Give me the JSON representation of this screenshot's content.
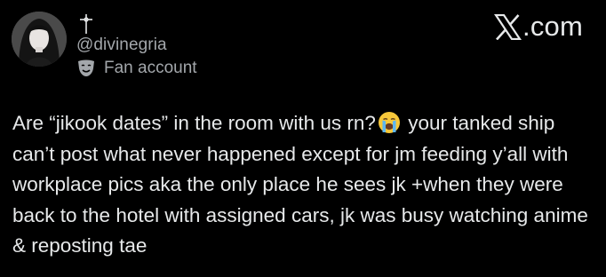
{
  "brand": {
    "logo_icon": "x-logo-icon",
    "suffix": ".com"
  },
  "author": {
    "name_icon": "dagger-cross-icon",
    "handle": "@divinegria",
    "badge_icon": "theater-mask-icon",
    "badge_label": "Fan account"
  },
  "tweet": {
    "text_before_emoji": "Are “jikook dates” in the room with us rn?",
    "emoji": "loudly-crying-face-emoji",
    "text_after_emoji": " your tanked ship can’t post what never happened except for jm feeding y’all with workplace pics aka the only place he sees jk +when they were back to the hotel with assigned cars, jk was busy watching anime & reposting tae"
  },
  "colors": {
    "background": "#000000",
    "text_primary": "#e7e9ea",
    "text_secondary": "#a3a7ab"
  }
}
